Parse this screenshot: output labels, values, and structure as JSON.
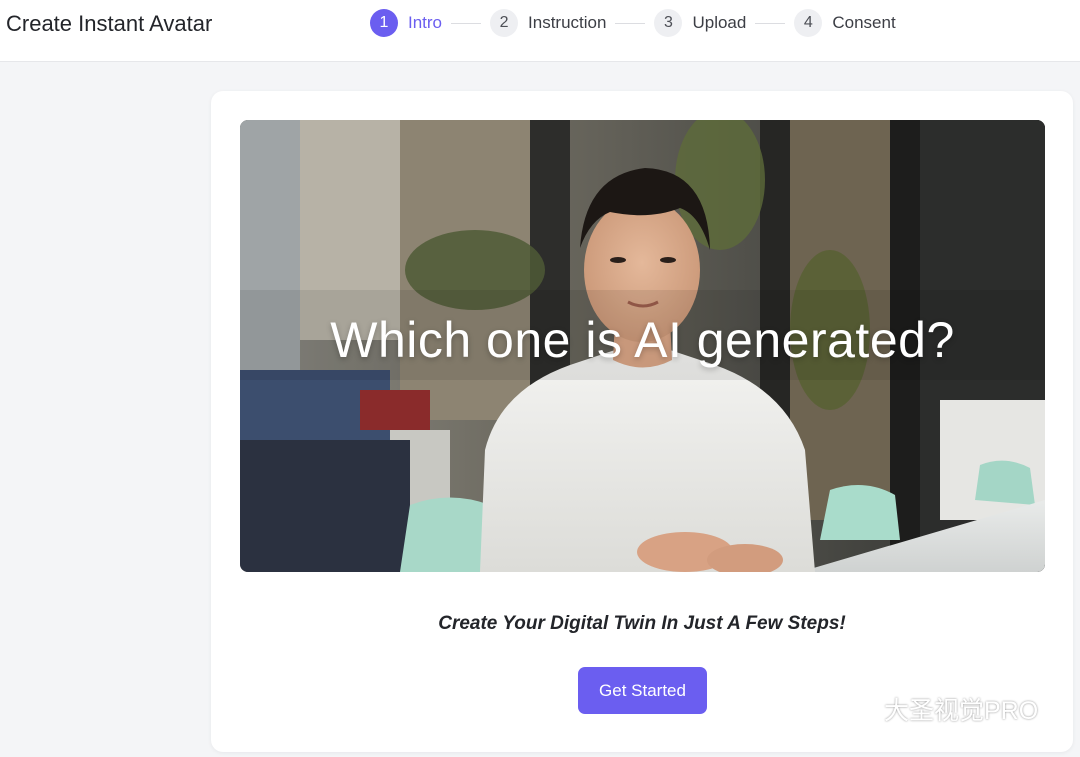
{
  "header": {
    "title": "Create Instant Avatar",
    "steps": [
      {
        "number": "1",
        "label": "Intro",
        "active": true
      },
      {
        "number": "2",
        "label": "Instruction",
        "active": false
      },
      {
        "number": "3",
        "label": "Upload",
        "active": false
      },
      {
        "number": "4",
        "label": "Consent",
        "active": false
      }
    ]
  },
  "video": {
    "caption": "Which one is AI generated?"
  },
  "main": {
    "tagline": "Create Your Digital Twin In Just A Few Steps!",
    "cta_label": "Get Started"
  },
  "watermark": {
    "text": "大圣视觉PRO",
    "icon": "wechat-icon"
  },
  "colors": {
    "accent": "#6b5ef0",
    "page_background": "#f4f5f7",
    "card_background": "#ffffff",
    "title_text": "#23252a"
  }
}
